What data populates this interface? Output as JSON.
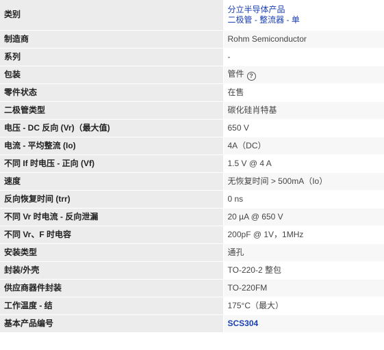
{
  "colors": {
    "link": "#1a3fb3",
    "label_bg": "#ececec"
  },
  "category": {
    "label": "类别",
    "line1": "分立半导体产品",
    "line2": "二极管 - 整流器 - 单"
  },
  "rows": [
    {
      "label": "制造商",
      "value": "Rohm Semiconductor"
    },
    {
      "label": "系列",
      "value": "-"
    },
    {
      "label": "包装",
      "value": "管件",
      "icon": "help-circle-icon"
    },
    {
      "label": "零件状态",
      "value": "在售"
    },
    {
      "label": "二极管类型",
      "value": "碳化硅肖特基"
    },
    {
      "label": "电压 - DC 反向 (Vr)（最大值)",
      "value": "650 V"
    },
    {
      "label": "电流 - 平均整流 (Io)",
      "value": "4A（DC）"
    },
    {
      "label": "不同 If 时电压 - 正向 (Vf)",
      "value": "1.5 V @ 4 A"
    },
    {
      "label": "速度",
      "value": "无恢复时间 > 500mA（Io）"
    },
    {
      "label": "反向恢复时间 (trr)",
      "value": "0 ns"
    },
    {
      "label": "不同 Vr 时电流 - 反向泄漏",
      "value": "20 µA @ 650 V"
    },
    {
      "label": "不同 Vr、F 时电容",
      "value": "200pF @ 1V，1MHz"
    },
    {
      "label": "安装类型",
      "value": "通孔"
    },
    {
      "label": "封装/外壳",
      "value": "TO-220-2 整包"
    },
    {
      "label": "供应商器件封装",
      "value": "TO-220FM"
    },
    {
      "label": "工作温度 - 结",
      "value": "175°C（最大）"
    },
    {
      "label": "基本产品编号",
      "value": "SCS304"
    }
  ]
}
